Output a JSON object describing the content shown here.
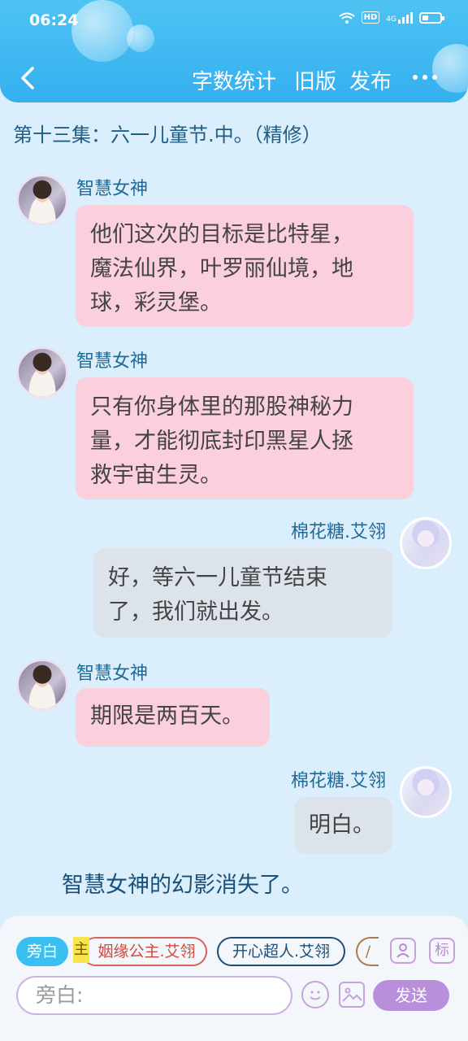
{
  "status_bar": {
    "time": "06:24",
    "hd": "HD",
    "network": "4G"
  },
  "header": {
    "word_count": "字数统计",
    "old_version": "旧版",
    "publish": "发布"
  },
  "episode_title": "第十三集：六一儿童节.中。（精修）",
  "messages": [
    {
      "speaker": "智慧女神",
      "text_lines": [
        "他们这次的目标是比特星，",
        "魔法仙界，叶罗丽仙境，地",
        "球，彩灵堡。"
      ]
    },
    {
      "speaker": "智慧女神",
      "text_lines": [
        "只有你身体里的那股神秘力",
        "量，才能彻底封印黑星人拯",
        "救宇宙生灵。"
      ]
    },
    {
      "speaker": "棉花糖.艾翎",
      "text_lines": [
        "好，等六一儿童节结束",
        "了，我们就出发。"
      ]
    },
    {
      "speaker": "智慧女神",
      "text_lines": [
        "期限是两百天。"
      ]
    },
    {
      "speaker": "棉花糖.艾翎",
      "text_lines": [
        "明白。"
      ]
    }
  ],
  "narration": "智慧女神的幻影消失了。",
  "input_bar": {
    "chips": {
      "narration": "旁白",
      "main_tag": "主",
      "role1": "姻缘公主.艾翎",
      "role2": "开心超人.艾翎",
      "role3_partial": "/"
    },
    "icon_mark": "标",
    "placeholder": "旁白:",
    "send": "发送"
  },
  "colors": {
    "header": "#34b0ef",
    "left_bubble": "#fbcfdb",
    "right_bubble": "#dde3eb",
    "send_button": "#b98fdc"
  }
}
